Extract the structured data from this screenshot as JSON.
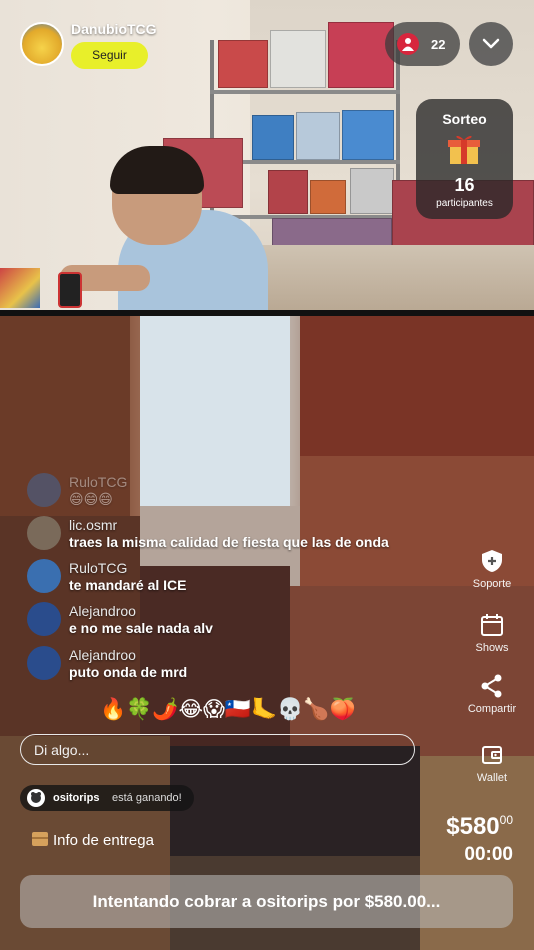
{
  "host": {
    "name": "DanubioTCG",
    "follow_label": "Seguir"
  },
  "viewers": {
    "count": "22"
  },
  "giveaway": {
    "title": "Sorteo",
    "count": "16",
    "label": "participantes"
  },
  "chat": [
    {
      "user": "RuloTCG",
      "message": "😄😄😄",
      "faded": true,
      "avatar_color": "#3a6fb0"
    },
    {
      "user": "lic.osmr",
      "message": "traes la misma calidad de fiesta que las de onda",
      "faded": false,
      "avatar_color": "#7a6a5a"
    },
    {
      "user": "RuloTCG",
      "message": "te mandaré al ICE",
      "faded": false,
      "avatar_color": "#3a6fb0"
    },
    {
      "user": "Alejandroo",
      "message": "e no me sale nada alv",
      "faded": false,
      "avatar_color": "#2a4c8c"
    },
    {
      "user": "Alejandroo",
      "message": "puto onda de mrd",
      "faded": false,
      "avatar_color": "#2a4c8c"
    }
  ],
  "reactions": "🔥🍀🌶️😂😱🇨🇱🦶💀🍗🍑",
  "input": {
    "placeholder": "Di algo..."
  },
  "winner": {
    "user": "ositorips",
    "text": "está ganando!"
  },
  "delivery_label": "Info de entrega",
  "price": {
    "main": "$580",
    "cents": "00"
  },
  "timer": "00:00",
  "charge_status": "Intentando cobrar a ositorips por $580.00...",
  "rail": [
    {
      "icon": "shield-plus-icon",
      "label": "Soporte"
    },
    {
      "icon": "calendar-icon",
      "label": "Shows"
    },
    {
      "icon": "share-icon",
      "label": "Compartir"
    },
    {
      "icon": "wallet-icon",
      "label": "Wallet"
    }
  ],
  "colors": {
    "follow": "#e8ef2a",
    "viewer_dot": "#d7263d"
  }
}
